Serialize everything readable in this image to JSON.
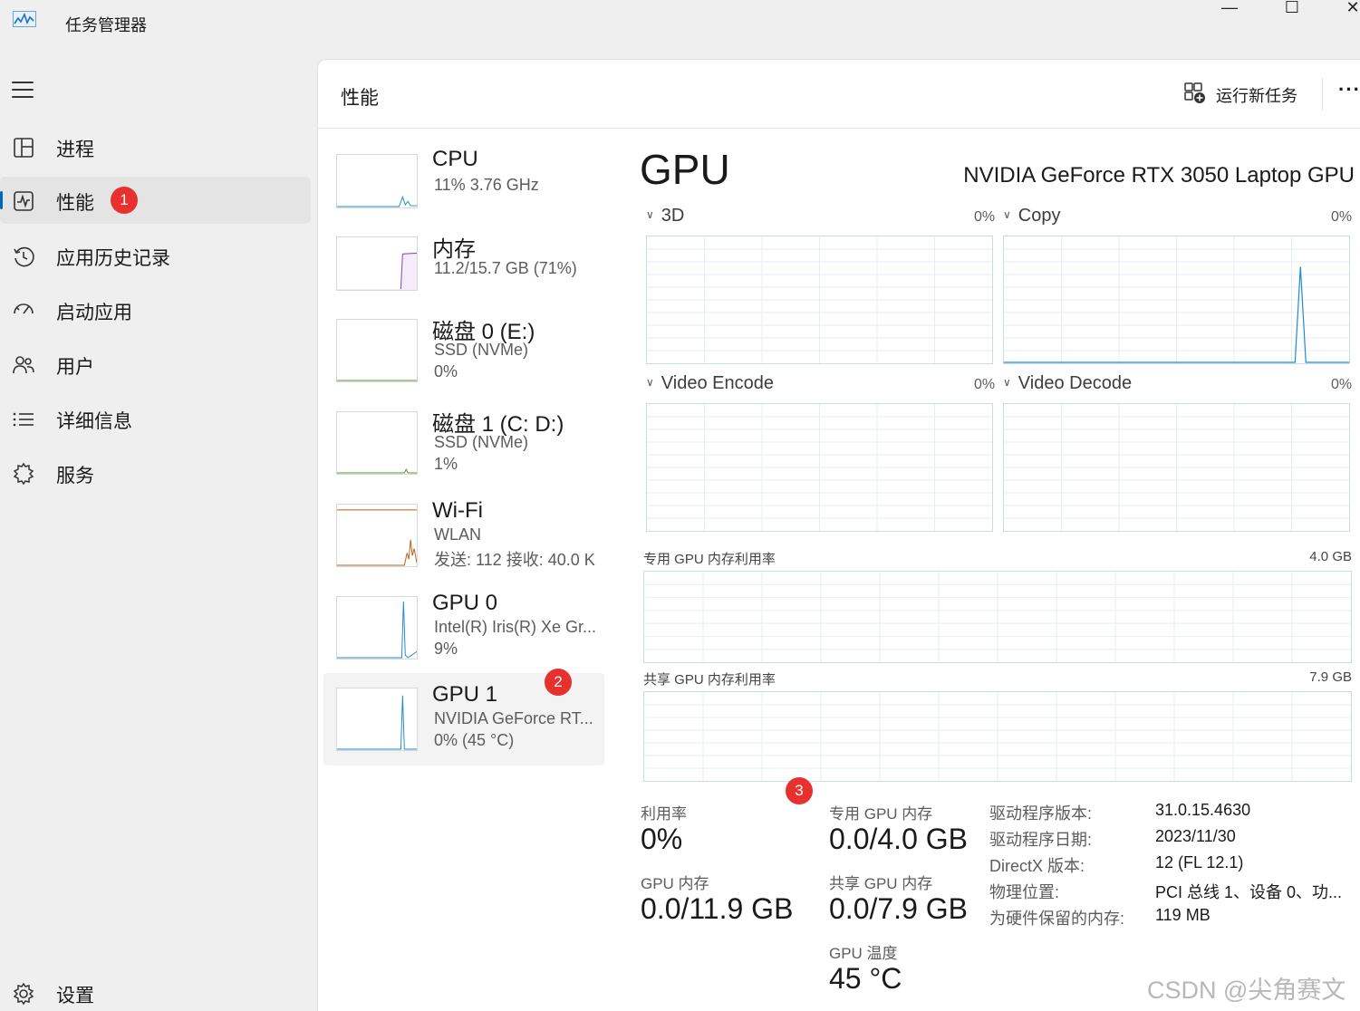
{
  "window": {
    "title": "任务管理器",
    "minimize": "—",
    "maximize": "☐",
    "close": "✕"
  },
  "sidebar": {
    "items": [
      {
        "label": "进程",
        "icon": "processes-icon"
      },
      {
        "label": "性能",
        "icon": "performance-icon",
        "active": true,
        "badge": "1"
      },
      {
        "label": "应用历史记录",
        "icon": "history-icon"
      },
      {
        "label": "启动应用",
        "icon": "startup-icon"
      },
      {
        "label": "用户",
        "icon": "users-icon"
      },
      {
        "label": "详细信息",
        "icon": "details-icon"
      },
      {
        "label": "服务",
        "icon": "services-icon"
      }
    ],
    "settings": "设置"
  },
  "header": {
    "title": "性能",
    "run_task": "运行新任务",
    "more": "···"
  },
  "resources": [
    {
      "title": "CPU",
      "line1": "11%  3.76 GHz",
      "line2": ""
    },
    {
      "title": "内存",
      "line1": "11.2/15.7 GB (71%)",
      "line2": ""
    },
    {
      "title": "磁盘 0 (E:)",
      "line1": "SSD (NVMe)",
      "line2": "0%"
    },
    {
      "title": "磁盘 1 (C: D:)",
      "line1": "SSD (NVMe)",
      "line2": "1%"
    },
    {
      "title": "Wi-Fi",
      "line1": "WLAN",
      "line2": "发送: 112  接收: 40.0 K"
    },
    {
      "title": "GPU 0",
      "line1": "Intel(R) Iris(R) Xe Gr...",
      "line2": "9%"
    },
    {
      "title": "GPU 1",
      "line1": "NVIDIA GeForce RT...",
      "line2": "0%  (45 °C)",
      "active": true,
      "badge": "2"
    }
  ],
  "detail": {
    "title": "GPU",
    "device_name": "NVIDIA GeForce RTX 3050 Laptop GPU",
    "engines": [
      {
        "name": "3D",
        "pct": "0%"
      },
      {
        "name": "Copy",
        "pct": "0%"
      },
      {
        "name": "Video Encode",
        "pct": "0%"
      },
      {
        "name": "Video Decode",
        "pct": "0%"
      }
    ],
    "dedicated_mem_label": "专用 GPU 内存利用率",
    "dedicated_mem_max": "4.0 GB",
    "shared_mem_label": "共享 GPU 内存利用率",
    "shared_mem_max": "7.9 GB",
    "badge3": "3",
    "stats": {
      "util_label": "利用率",
      "util_value": "0%",
      "ded_label": "专用 GPU 内存",
      "ded_value": "0.0/4.0 GB",
      "gpu_mem_label": "GPU 内存",
      "gpu_mem_value": "0.0/11.9 GB",
      "shared_label": "共享 GPU 内存",
      "shared_value": "0.0/7.9 GB",
      "temp_label": "GPU 温度",
      "temp_value": "45 °C"
    },
    "info": [
      {
        "key": "驱动程序版本:",
        "value": "31.0.15.4630"
      },
      {
        "key": "驱动程序日期:",
        "value": "2023/11/30"
      },
      {
        "key": "DirectX 版本:",
        "value": "12 (FL 12.1)"
      },
      {
        "key": "物理位置:",
        "value": "PCI 总线 1、设备 0、功..."
      },
      {
        "key": "为硬件保留的内存:",
        "value": "119 MB"
      }
    ]
  },
  "watermark": "CSDN @尖角赛文",
  "colors": {
    "accent": "#0067c0",
    "badge": "#e8302e",
    "graph_line": "#1f8ad2",
    "memory_line": "#8b3fb0",
    "wifi_line": "#b45f1c",
    "disk_line": "#4c9a2a"
  }
}
